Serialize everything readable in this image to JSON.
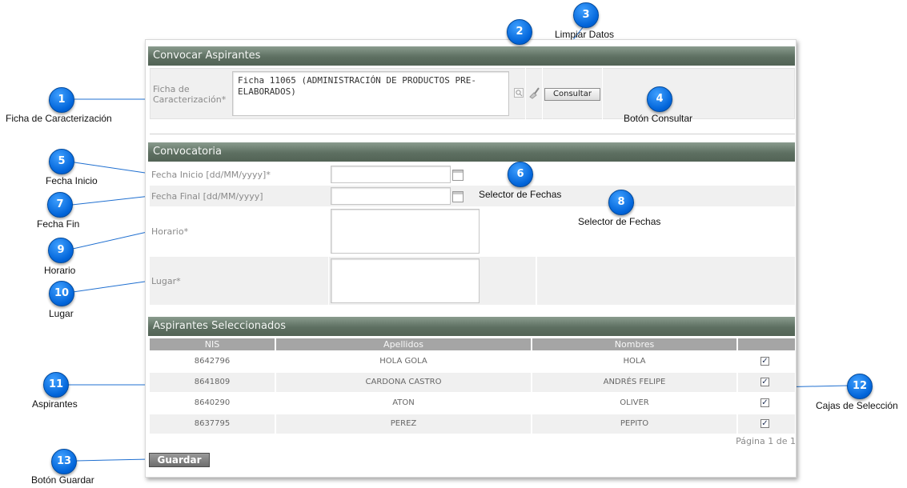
{
  "section1": {
    "title": "Convocar Aspirantes",
    "ficha_label_1": "Ficha de",
    "ficha_label_2": "Caracterización*",
    "ficha_value": "Ficha 11065 (ADMINISTRACIÓN DE PRODUCTOS PRE-ELABORADOS)",
    "search_icon": "magnifier-icon",
    "clear_icon": "broom-icon",
    "consultar_label": "Consultar"
  },
  "section2": {
    "title": "Convocatoria",
    "fecha_inicio_label": "Fecha Inicio [dd/MM/yyyy]*",
    "fecha_final_label": "Fecha Final [dd/MM/yyyy]",
    "horario_label": "Horario*",
    "lugar_label": "Lugar*",
    "calendar_icon": "calendar-icon"
  },
  "section3": {
    "title": "Aspirantes Seleccionados",
    "columns": [
      "NIS",
      "Apellidos",
      "Nombres"
    ],
    "rows": [
      {
        "nis": "8642796",
        "apellidos": "HOLA GOLA",
        "nombres": "HOLA",
        "checked": true
      },
      {
        "nis": "8641809",
        "apellidos": "CARDONA CASTRO",
        "nombres": "ANDRÉS FELIPE",
        "checked": true
      },
      {
        "nis": "8640290",
        "apellidos": "ATON",
        "nombres": "OLIVER",
        "checked": true
      },
      {
        "nis": "8637795",
        "apellidos": "PEREZ",
        "nombres": "PEPITO",
        "checked": true
      }
    ],
    "pagination": "Página 1 de 1"
  },
  "guardar_label": "Guardar",
  "annotations": [
    {
      "num": "1",
      "text": "Ficha de Caracterización"
    },
    {
      "num": "2",
      "text": ""
    },
    {
      "num": "3",
      "text": "Limpiar Datos"
    },
    {
      "num": "4",
      "text": "Botón Consultar"
    },
    {
      "num": "5",
      "text": "Fecha Inicio"
    },
    {
      "num": "6",
      "text": "Selector de Fechas"
    },
    {
      "num": "7",
      "text": "Fecha Fin"
    },
    {
      "num": "8",
      "text": "Selector de Fechas"
    },
    {
      "num": "9",
      "text": "Horario"
    },
    {
      "num": "10",
      "text": "Lugar"
    },
    {
      "num": "11",
      "text": "Aspirantes"
    },
    {
      "num": "12",
      "text": "Cajas de Selección"
    },
    {
      "num": "13",
      "text": "Botón Guardar"
    }
  ],
  "colors": {
    "header": "#5d6f61",
    "bubble": "#0063d8",
    "table_header": "#a5a5a5"
  }
}
